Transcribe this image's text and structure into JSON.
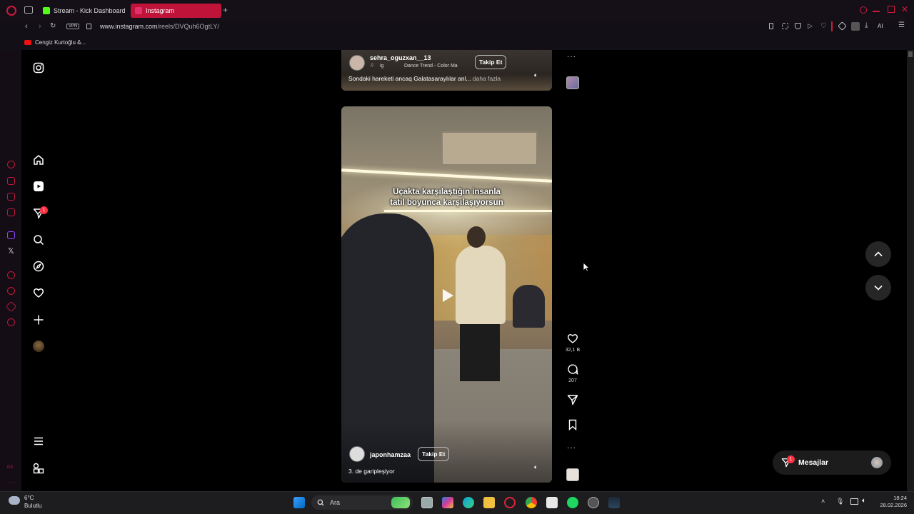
{
  "browser": {
    "tabs": [
      {
        "label": "Stream - Kick Dashboard",
        "favicon_color": "#53fc18"
      },
      {
        "label": "Instagram",
        "favicon_color": "#e1306c"
      }
    ],
    "vpn_label": "VPN",
    "url_prefix": "www.instagram.com",
    "url_path": "/reels/DVQuh6OgtLY/",
    "bookmark": "Cengiz Kurtoğlu &...",
    "ai_label": "AI"
  },
  "nav": {
    "notification_count": "1"
  },
  "reel_top": {
    "username": "sehra_oguzxan__13",
    "music_left": "ig",
    "music": "Dance Trend - Color Ma",
    "follow_label": "Takip Et",
    "caption": "Sondaki hareketi ancaq Galatasaraylılar anl...",
    "more": "daha fazla"
  },
  "reel_main": {
    "overlay_line1": "Uçakta karşılaştığın insanla",
    "overlay_line2": "tatil boyunca karşılaşıyorsun",
    "username": "japonhamzaa",
    "follow_label": "Takip Et",
    "caption": "3. de garipleşiyor",
    "likes": "32,1 B",
    "comments": "207"
  },
  "messages": {
    "label": "Mesajlar",
    "badge": "1"
  },
  "taskbar": {
    "temperature": "6°C",
    "weather": "Bulutlu",
    "search_placeholder": "Ara",
    "time": "18:24",
    "date": "28.02.2026"
  },
  "colors": {
    "accent": "#c0133a",
    "like_badge": "#ff3040"
  }
}
